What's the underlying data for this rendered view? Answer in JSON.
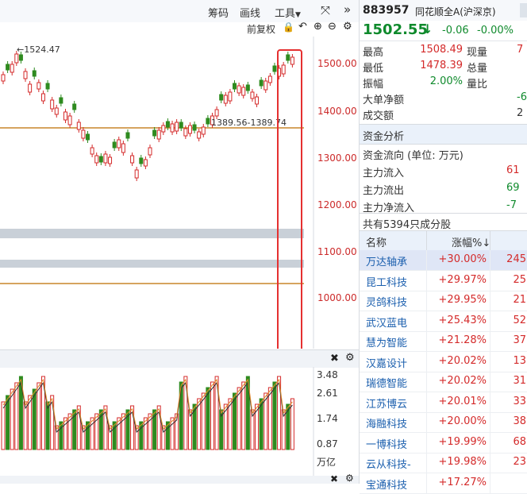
{
  "toolbar": {
    "chouma": "筹码",
    "huaxian": "画线",
    "tools": "工具",
    "qianfuquan": "前复权"
  },
  "chart": {
    "high_marker": "←1524.47",
    "cost_label": "1389.56-1389.74",
    "y_ticks": [
      "1500.00",
      "1400.00",
      "1300.00",
      "1200.00",
      "1100.00",
      "1000.00"
    ],
    "vol_ticks": [
      "3.48",
      "2.61",
      "1.74",
      "0.87"
    ],
    "vol_unit": "万亿",
    "colors": {
      "up": "#d42a2a",
      "down": "#2e8b1f",
      "cost_line": "#c8862a",
      "highlight_box": "#e53030"
    }
  },
  "quote": {
    "code": "883957",
    "name": "同花顺全A(沪深京)",
    "price": "1502.55",
    "arrow": "↓",
    "change": "-0.06",
    "change_pct": "-0.00%",
    "stats": [
      {
        "label": "最高",
        "value": "1508.49",
        "label2": "现量",
        "value2": "7",
        "color": "red"
      },
      {
        "label": "最低",
        "value": "1478.39",
        "label2": "总量",
        "value2": "",
        "color": "red"
      },
      {
        "label": "振幅",
        "value": "2.00%",
        "label2": "量比",
        "value2": "",
        "color": "green"
      },
      {
        "label": "大单净额",
        "value": "",
        "label2": "",
        "value2": "-6",
        "color": "green"
      },
      {
        "label": "成交额",
        "value": "",
        "label2": "",
        "value2": "2",
        "color": "dark"
      }
    ]
  },
  "fund": {
    "title": "资金分析",
    "rows": [
      {
        "label": "资金流向 (单位: 万元)",
        "value": ""
      },
      {
        "label": "主力流入",
        "value": "61"
      },
      {
        "label": "主力流出",
        "value": "69"
      },
      {
        "label": "主力净流入",
        "value": "-7"
      }
    ]
  },
  "constituents": {
    "summary": "共有5394只成分股",
    "headers": {
      "name": "名称",
      "pct": "涨幅%↓"
    },
    "rows": [
      {
        "name": "万达轴承",
        "pct": "+30.00%",
        "more": "245"
      },
      {
        "name": "昆工科技",
        "pct": "+29.97%",
        "more": "25"
      },
      {
        "name": "灵鸽科技",
        "pct": "+29.95%",
        "more": "21"
      },
      {
        "name": "武汉蓝电",
        "pct": "+25.43%",
        "more": "52"
      },
      {
        "name": "慧为智能",
        "pct": "+21.28%",
        "more": "37"
      },
      {
        "name": "汉嘉设计",
        "pct": "+20.02%",
        "more": "13"
      },
      {
        "name": "瑞德智能",
        "pct": "+20.02%",
        "more": "31"
      },
      {
        "name": "江苏博云",
        "pct": "+20.01%",
        "more": "33"
      },
      {
        "name": "海融科技",
        "pct": "+20.00%",
        "more": "38"
      },
      {
        "name": "一博科技",
        "pct": "+19.99%",
        "more": "68"
      },
      {
        "name": "云从科技-",
        "pct": "+19.98%",
        "more": "23"
      },
      {
        "name": "宝通科技",
        "pct": "+17.27%",
        "more": ""
      }
    ]
  }
}
